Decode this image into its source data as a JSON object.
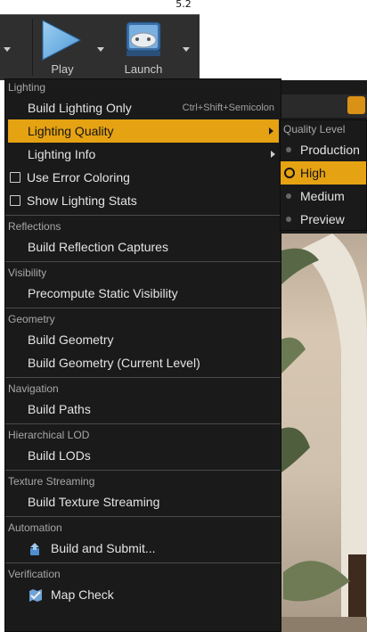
{
  "caption": "5.2",
  "toolbar": {
    "play_label": "Play",
    "launch_label": "Launch"
  },
  "menu": {
    "lighting_header": "Lighting",
    "build_lighting_only": "Build Lighting Only",
    "build_lighting_shortcut": "Ctrl+Shift+Semicolon",
    "lighting_quality": "Lighting Quality",
    "lighting_info": "Lighting Info",
    "use_error_coloring": "Use Error Coloring",
    "show_lighting_stats": "Show Lighting Stats",
    "reflections_header": "Reflections",
    "build_reflection_captures": "Build Reflection Captures",
    "visibility_header": "Visibility",
    "precompute_static_visibility": "Precompute Static Visibility",
    "geometry_header": "Geometry",
    "build_geometry": "Build Geometry",
    "build_geometry_current": "Build Geometry (Current Level)",
    "navigation_header": "Navigation",
    "build_paths": "Build Paths",
    "hlod_header": "Hierarchical LOD",
    "build_lods": "Build LODs",
    "texture_streaming_header": "Texture Streaming",
    "build_texture_streaming": "Build Texture Streaming",
    "automation_header": "Automation",
    "build_and_submit": "Build and Submit...",
    "verification_header": "Verification",
    "map_check": "Map Check"
  },
  "submenu": {
    "header": "Quality Level",
    "items": [
      "Production",
      "High",
      "Medium",
      "Preview"
    ],
    "selected": "High"
  },
  "colors": {
    "highlight": "#e5a212",
    "menu_bg": "#1a1a1a",
    "toolbar_bg": "#2f2f2f"
  }
}
